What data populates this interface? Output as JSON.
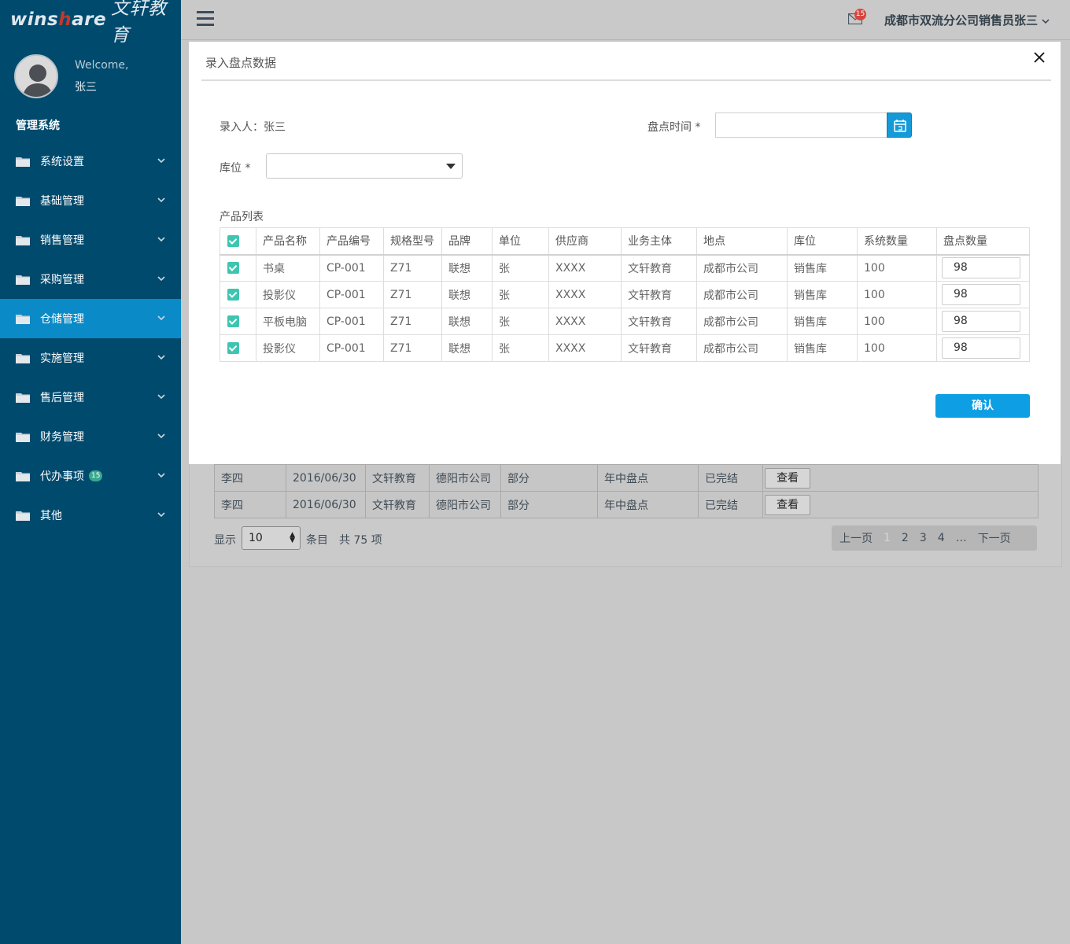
{
  "brand": {
    "logo_en_1": "wins",
    "logo_en_h": "h",
    "logo_en_2": "are",
    "logo_cn": "文轩教育",
    "accent_color": "#c0392b"
  },
  "sidebar": {
    "welcome": "Welcome,",
    "user": "张三",
    "section": "管理系统",
    "items": [
      {
        "label": "系统设置",
        "icon": "folder-icon"
      },
      {
        "label": "基础管理",
        "icon": "folder-icon"
      },
      {
        "label": "销售管理",
        "icon": "folder-icon"
      },
      {
        "label": "采购管理",
        "icon": "folder-icon"
      },
      {
        "label": "仓储管理",
        "icon": "folder-icon",
        "active": true
      },
      {
        "label": "实施管理",
        "icon": "folder-icon"
      },
      {
        "label": "售后管理",
        "icon": "folder-icon"
      },
      {
        "label": "财务管理",
        "icon": "folder-icon"
      },
      {
        "label": "代办事项",
        "icon": "folder-icon",
        "badge": "15"
      },
      {
        "label": "其他",
        "icon": "folder-icon"
      }
    ],
    "colors": {
      "bg": "#004a6e",
      "active": "#0a8ac7"
    }
  },
  "topbar": {
    "mail_count": "15",
    "user_label": "成都市双流分公司销售员张三",
    "dropdown_icon": "chevron-down-icon"
  },
  "modal": {
    "title": "录入盘点数据",
    "recorder_label": "录入人：",
    "recorder_name": "张三",
    "date_label": "盘点时间 *",
    "date_value": "",
    "location_label": "库位 *",
    "location_value": "",
    "list_label": "产品列表",
    "columns": [
      "产品名称",
      "产品编号",
      "规格型号",
      "品牌",
      "单位",
      "供应商",
      "业务主体",
      "地点",
      "库位",
      "系统数量",
      "盘点数量"
    ],
    "rows": [
      [
        "书桌",
        "CP-001",
        "Z71",
        "联想",
        "张",
        "XXXX",
        "文轩教育",
        "成都市公司",
        "销售库",
        "100",
        "98"
      ],
      [
        "投影仪",
        "CP-001",
        "Z71",
        "联想",
        "张",
        "XXXX",
        "文轩教育",
        "成都市公司",
        "销售库",
        "100",
        "98"
      ],
      [
        "平板电脑",
        "CP-001",
        "Z71",
        "联想",
        "张",
        "XXXX",
        "文轩教育",
        "成都市公司",
        "销售库",
        "100",
        "98"
      ],
      [
        "投影仪",
        "CP-001",
        "Z71",
        "联想",
        "张",
        "XXXX",
        "文轩教育",
        "成都市公司",
        "销售库",
        "100",
        "98"
      ]
    ],
    "confirm_label": "确认",
    "accent": "#0d9ee3",
    "checkbox_color": "#3ec5b0"
  },
  "background_table": {
    "rows": [
      [
        "李四",
        "2016/06/30",
        "文轩教育",
        "德阳市公司",
        "部分",
        "年中盘点",
        "已完结",
        "查看"
      ],
      [
        "李四",
        "2016/06/30",
        "文轩教育",
        "德阳市公司",
        "部分",
        "年中盘点",
        "已完结",
        "查看"
      ]
    ],
    "show_label": "显示",
    "page_size": "10",
    "entries_label": "条目",
    "total_label": "共 75 项",
    "pager": {
      "prev": "上一页",
      "pages": [
        "1",
        "2",
        "3",
        "4",
        "…"
      ],
      "next": "下一页",
      "current": "1"
    }
  }
}
